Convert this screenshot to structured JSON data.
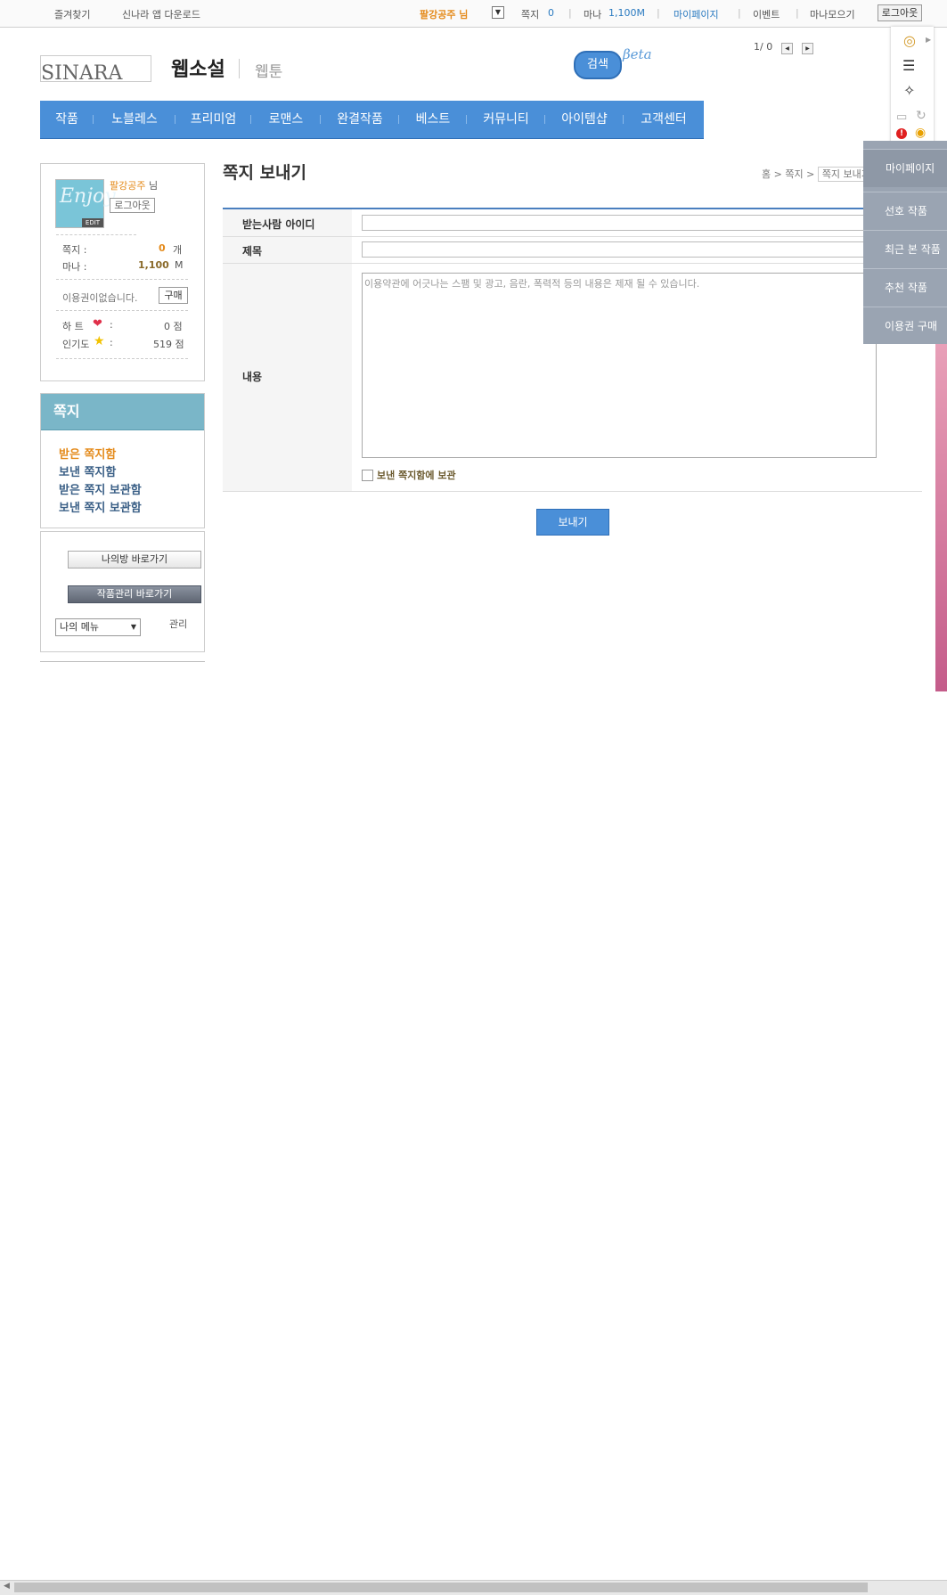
{
  "topbar": {
    "favorites": "즐겨찾기",
    "app_download": "신나라 앱 다운로드",
    "username": "팔강공주 님",
    "memo_label": "쪽지",
    "memo_count": "0",
    "mana_label": "마나",
    "mana_value": "1,100M",
    "mypage": "마이페이지",
    "event": "이벤트",
    "mana_collect": "마나모으기",
    "logout": "로그아웃",
    "separator": "|"
  },
  "header": {
    "logo_alt": "SINARA",
    "category_active": "웹소설",
    "category_other": "웹툰",
    "search_button": "검색",
    "beta": "βeta",
    "pager": "1/ 0"
  },
  "nav": [
    "작품",
    "노블레스",
    "프리미엄",
    "로맨스",
    "완결작품",
    "베스트",
    "커뮤니티",
    "아이템샵",
    "고객센터"
  ],
  "user": {
    "name": "팔강공주",
    "suffix": "님",
    "logout": "로그아웃",
    "memo_label": "쪽지 :",
    "memo_value": "0",
    "memo_unit": "개",
    "mana_label": "마나 :",
    "mana_value": "1,100",
    "mana_unit": "M",
    "ticket_status": "이용권이없습니다.",
    "buy": "구매",
    "heart_label": "하   트",
    "heart_value": "0 점",
    "pop_label": "인기도",
    "pop_value": "519 점",
    "colon": ":",
    "avatar_text": "Enjoy",
    "avatar_badge": "EDIT"
  },
  "memo_menu": {
    "title": "쪽지",
    "items": [
      "받은 쪽지함",
      "보낸 쪽지함",
      "받은 쪽지 보관함",
      "보낸 쪽지 보관함"
    ],
    "active_color": "#e48a1a"
  },
  "shortcuts": {
    "my_room": "나의방 바로가기",
    "work_manage": "작품관리 바로가기",
    "my_menu": "나의 메뉴",
    "manage": "관리"
  },
  "content": {
    "title": "쪽지 보내기",
    "breadcrumb_home": "홈",
    "breadcrumb_memo": "쪽지",
    "breadcrumb_current": "쪽지 보내기",
    "crumb_sep": ">",
    "recipient_label": "받는사람 아이디",
    "subject_label": "제목",
    "body_label": "내용",
    "body_placeholder": "이용약관에 어긋나는 스팸 및 광고, 음란, 폭력적 등의 내용은 제재 될 수 있습니다.",
    "save_label": "보낸 쪽지함에 보관",
    "send": "보내기"
  },
  "right_menu": [
    "마이페이지",
    "선호 작품",
    "최근 본 작품",
    "추천 작품",
    "이용권 구매"
  ],
  "colors": {
    "nav_blue": "#4a8fd8",
    "memo_head": "#7ab6c8",
    "orange": "#e48a1a"
  }
}
